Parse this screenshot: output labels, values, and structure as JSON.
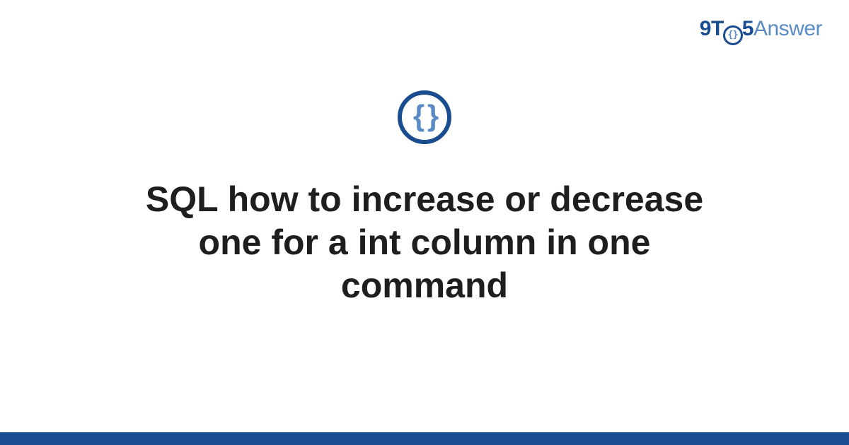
{
  "brand": {
    "part1": "9",
    "part2": "T",
    "clock_inner": "{}",
    "part3": "5",
    "part4": "Answer"
  },
  "category_icon": {
    "glyph": "{ }",
    "name": "code-braces-icon"
  },
  "title": "SQL how to increase or decrease one for a int column in one command",
  "colors": {
    "primary": "#1a4d8f",
    "secondary": "#5a8bc4",
    "text": "#1e1e1e"
  }
}
